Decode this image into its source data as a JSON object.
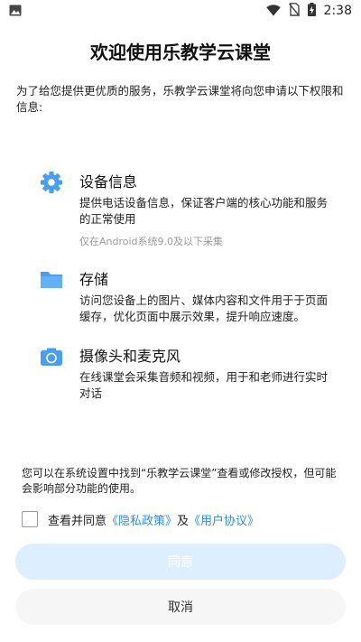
{
  "status_bar": {
    "time": "2:38"
  },
  "title": "欢迎使用乐教学云课堂",
  "intro": "为了给您提供更优质的服务，乐教学云课堂将向您申请以下权限和信息:",
  "permissions": [
    {
      "icon": "gear-icon",
      "title": "设备信息",
      "desc": "提供电话设备信息，保证客户端的核心功能和服务的正常使用",
      "note": "仅在Android系统9.0及以下采集"
    },
    {
      "icon": "folder-icon",
      "title": "存储",
      "desc": "访问您设备上的图片、媒体内容和文件用于于页面缓存，优化页面中展示效果，提升响应速度。"
    },
    {
      "icon": "camera-icon",
      "title": "摄像头和麦克风",
      "desc": "在线课堂会采集音频和视频，用于和老师进行实时对话"
    }
  ],
  "footer_note": "您可以在系统设置中找到“乐教学云课堂”查看或修改授权，但可能会影响部分功能的使用。",
  "consent": {
    "prefix": "查看并同意",
    "privacy_link": "《隐私政策》",
    "and": "及",
    "agreement_link": "《用户协议》",
    "checked": false
  },
  "buttons": {
    "agree": "同意",
    "cancel": "取消"
  },
  "colors": {
    "accent": "#2a8cf0",
    "icon_blue": "#4a9ef0",
    "agree_bg": "#dceeff",
    "cancel_bg": "#f6f6f6"
  }
}
